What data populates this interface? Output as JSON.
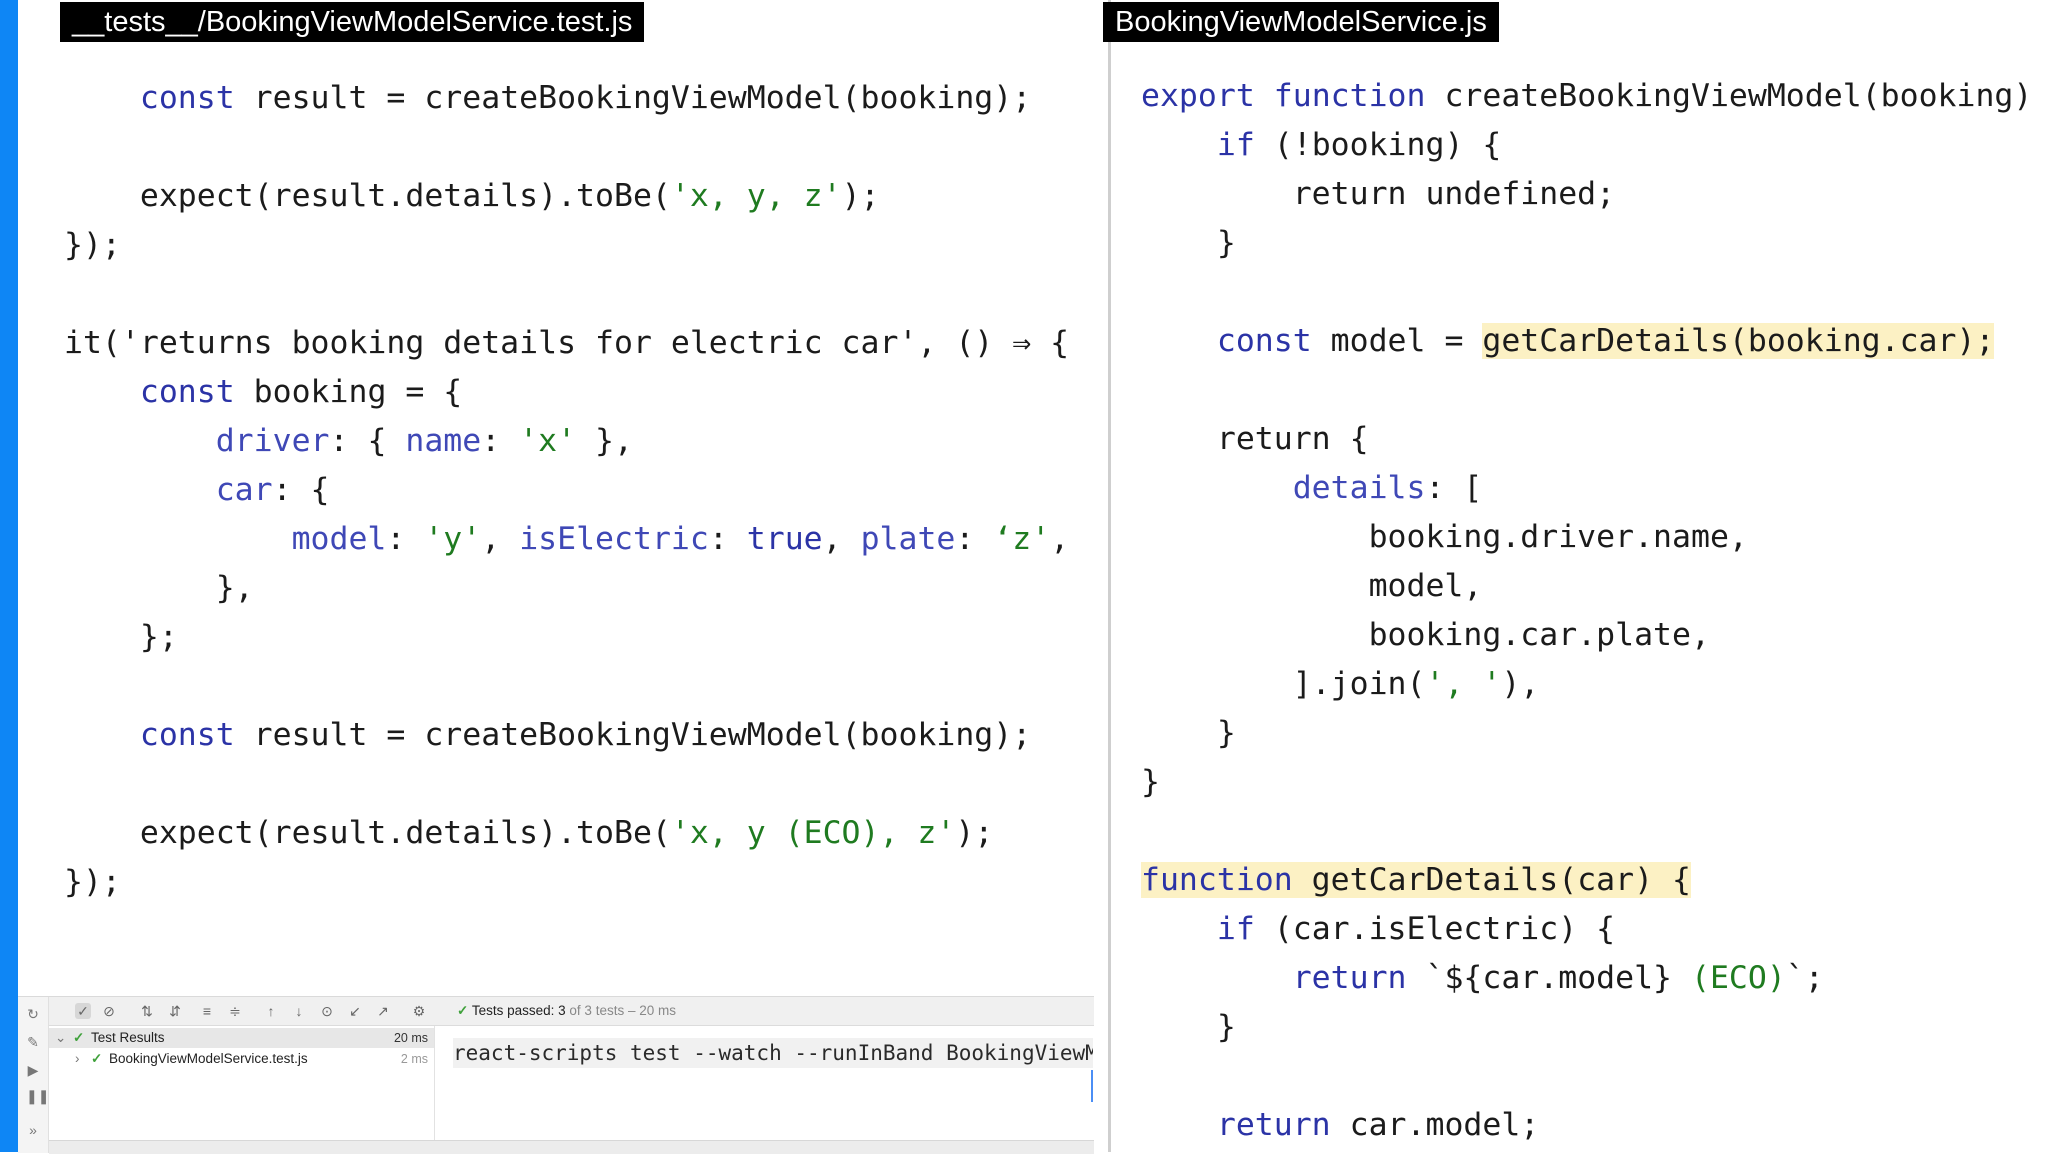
{
  "left_editor": {
    "tab_title": "__tests__/BookingViewModelService.test.js",
    "lines": [
      [
        [
          "    ",
          "t"
        ],
        [
          "const",
          "k"
        ],
        [
          " result = createBookingViewModel(booking);",
          "t"
        ]
      ],
      [],
      [
        [
          "    expect(result.details).toBe(",
          "t"
        ],
        [
          "'x, y, z'",
          "s"
        ],
        [
          ");",
          "t"
        ]
      ],
      [
        [
          "});",
          "t"
        ]
      ],
      [],
      [
        [
          "it('returns booking details for electric car', () ⇒ {",
          "t"
        ]
      ],
      [
        [
          "    ",
          "t"
        ],
        [
          "const",
          "k"
        ],
        [
          " booking = {",
          "t"
        ]
      ],
      [
        [
          "        ",
          "t"
        ],
        [
          "driver",
          "p"
        ],
        [
          ": { ",
          "t"
        ],
        [
          "name",
          "p"
        ],
        [
          ": ",
          "t"
        ],
        [
          "'x'",
          "s"
        ],
        [
          " },",
          "t"
        ]
      ],
      [
        [
          "        ",
          "t"
        ],
        [
          "car",
          "p"
        ],
        [
          ": {",
          "t"
        ]
      ],
      [
        [
          "            ",
          "t"
        ],
        [
          "model",
          "p"
        ],
        [
          ": ",
          "t"
        ],
        [
          "'y'",
          "s"
        ],
        [
          ", ",
          "t"
        ],
        [
          "isElectric",
          "p"
        ],
        [
          ": ",
          "t"
        ],
        [
          "true",
          "k"
        ],
        [
          ", ",
          "t"
        ],
        [
          "plate",
          "p"
        ],
        [
          ": ",
          "t"
        ],
        [
          "‘z'",
          "s"
        ],
        [
          ",",
          "t"
        ]
      ],
      [
        [
          "        },",
          "t"
        ]
      ],
      [
        [
          "    };",
          "t"
        ]
      ],
      [],
      [
        [
          "    ",
          "t"
        ],
        [
          "const",
          "k"
        ],
        [
          " result = createBookingViewModel(booking);",
          "t"
        ]
      ],
      [],
      [
        [
          "    expect(result.details).toBe(",
          "t"
        ],
        [
          "'x, y (ECO), z'",
          "s"
        ],
        [
          ");",
          "t"
        ]
      ],
      [
        [
          "});",
          "t"
        ]
      ]
    ]
  },
  "right_editor": {
    "tab_title": "BookingViewModelService.js",
    "lines": [
      [
        [
          "export",
          "k"
        ],
        [
          " ",
          "t"
        ],
        [
          "function",
          "k"
        ],
        [
          " createBookingViewModel(booking) {",
          "t"
        ]
      ],
      [
        [
          "    ",
          "t"
        ],
        [
          "if",
          "k"
        ],
        [
          " (!booking) {",
          "t"
        ]
      ],
      [
        [
          "        return undefined;",
          "t"
        ]
      ],
      [
        [
          "    }",
          "t"
        ]
      ],
      [],
      [
        [
          "    ",
          "t"
        ],
        [
          "const",
          "k"
        ],
        [
          " model = ",
          "t"
        ],
        [
          "getCarDetails(booking.car);",
          "h"
        ]
      ],
      [],
      [
        [
          "    return {",
          "t"
        ]
      ],
      [
        [
          "        ",
          "t"
        ],
        [
          "details",
          "p"
        ],
        [
          ": [",
          "t"
        ]
      ],
      [
        [
          "            booking.driver.name,",
          "t"
        ]
      ],
      [
        [
          "            model,",
          "t"
        ]
      ],
      [
        [
          "            booking.car.plate,",
          "t"
        ]
      ],
      [
        [
          "        ].join(",
          "t"
        ],
        [
          "', '",
          "s"
        ],
        [
          "),",
          "t"
        ]
      ],
      [
        [
          "    }",
          "t"
        ]
      ],
      [
        [
          "}",
          "t"
        ]
      ],
      [],
      [
        [
          "function",
          "hk"
        ],
        [
          " getCarDetails(car) {",
          "h"
        ]
      ],
      [
        [
          "    ",
          "t"
        ],
        [
          "if",
          "k"
        ],
        [
          " (car.isElectric) {",
          "t"
        ]
      ],
      [
        [
          "        ",
          "t"
        ],
        [
          "return",
          "k"
        ],
        [
          " `${car.model} ",
          "t"
        ],
        [
          "(ECO)",
          "s"
        ],
        [
          "`;",
          "t"
        ]
      ],
      [
        [
          "    }",
          "t"
        ]
      ],
      [],
      [
        [
          "    ",
          "t"
        ],
        [
          "return",
          "k"
        ],
        [
          " car.model;",
          "t"
        ]
      ]
    ]
  },
  "test_runner": {
    "status_prefix": "Tests passed:",
    "status_count": "3",
    "status_suffix": "of 3 tests – 20 ms",
    "tree": [
      {
        "label": "Test Results",
        "duration": "20 ms"
      },
      {
        "label": "BookingViewModelService.test.js",
        "duration": "2 ms"
      }
    ],
    "console_command": "react-scripts test --watch --runInBand BookingViewM"
  },
  "colors": {
    "keyword": "#2b33a6",
    "property": "#3f48b6",
    "string": "#1f7b20",
    "highlight": "#fcf1c4",
    "accent_bar": "#0e86f5"
  }
}
